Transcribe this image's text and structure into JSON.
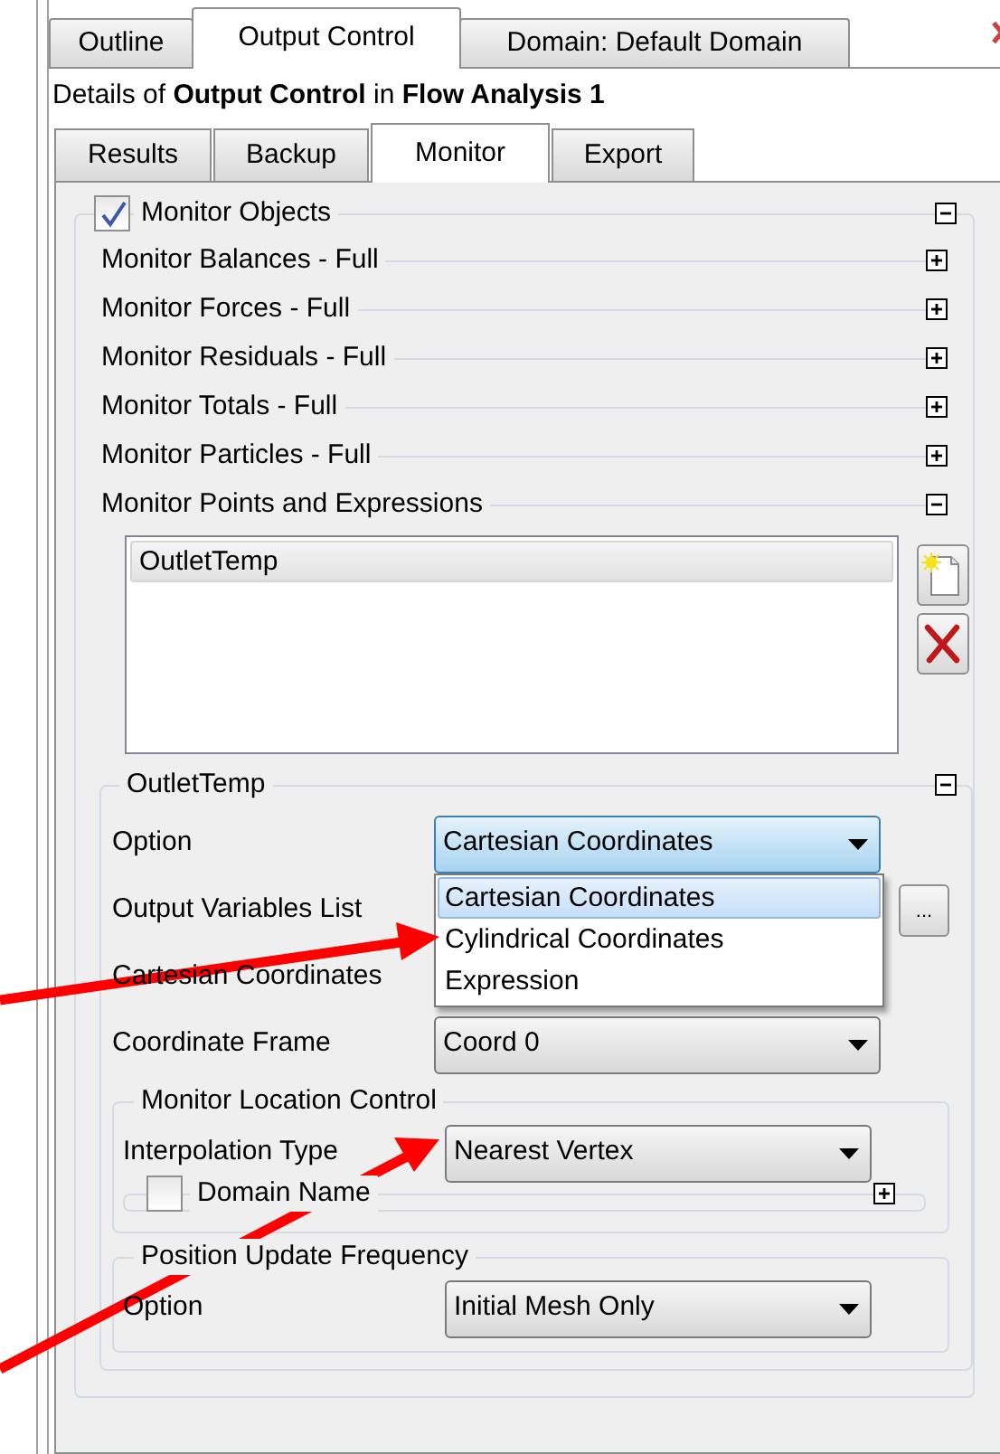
{
  "top_tabs": [
    {
      "label": "Outline",
      "selected": false
    },
    {
      "label": "Output Control",
      "selected": true
    },
    {
      "label": "Domain: Default Domain",
      "selected": false
    }
  ],
  "details": "Details of **Output Control** in **Flow Analysis 1**",
  "sub_tabs": [
    {
      "label": "Results",
      "selected": false
    },
    {
      "label": "Backup",
      "selected": false
    },
    {
      "label": "Monitor",
      "selected": true
    },
    {
      "label": "Export",
      "selected": false
    }
  ],
  "monitor_objects": {
    "label": "Monitor Objects",
    "checked": true,
    "expanded": true
  },
  "sections": [
    {
      "label": "Monitor Balances - Full",
      "expanded": false
    },
    {
      "label": "Monitor Forces - Full",
      "expanded": false
    },
    {
      "label": "Monitor Residuals - Full",
      "expanded": false
    },
    {
      "label": "Monitor Totals - Full",
      "expanded": false
    },
    {
      "label": "Monitor Particles - Full",
      "expanded": false
    },
    {
      "label": "Monitor Points and Expressions",
      "expanded": true
    }
  ],
  "points_list": [
    {
      "label": "OutletTemp",
      "selected": true
    }
  ],
  "point_group": {
    "title": "OutletTemp",
    "expanded": true,
    "fields": [
      {
        "kind": "combo",
        "label": "Option",
        "value": "Cartesian Coordinates",
        "open": true,
        "options": [
          {
            "label": "Cartesian Coordinates",
            "selected": true
          },
          {
            "label": "Cylindrical Coordinates",
            "selected": false
          },
          {
            "label": "Expression",
            "selected": false
          }
        ]
      },
      {
        "kind": "covered",
        "label": "Output Variables List",
        "button": "..."
      },
      {
        "kind": "covered",
        "label": "Cartesian Coordinates"
      },
      {
        "kind": "combo",
        "label": "Coordinate Frame",
        "value": "Coord 0",
        "open": false
      }
    ]
  },
  "location_control": {
    "title": "Monitor Location Control",
    "fields": [
      {
        "kind": "combo",
        "label": "Interpolation Type",
        "value": "Nearest Vertex",
        "open": false
      }
    ],
    "domain_name": {
      "label": "Domain Name",
      "checked": false,
      "expanded": false
    }
  },
  "update_frequency": {
    "title": "Position Update Frequency",
    "fields": [
      {
        "kind": "combo",
        "label": "Option",
        "value": "Initial Mesh Only",
        "open": false
      }
    ]
  }
}
